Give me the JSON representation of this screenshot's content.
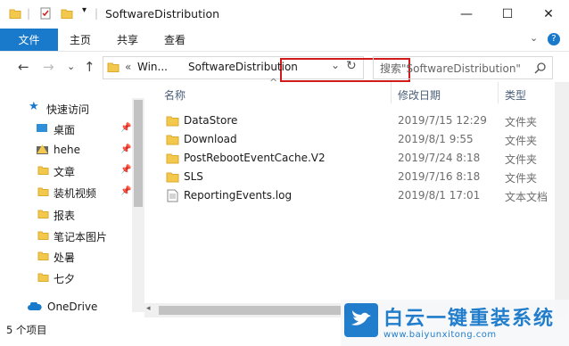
{
  "window": {
    "title": "SoftwareDistribution",
    "minimize_glyph": "—",
    "maximize_glyph": "☐",
    "close_glyph": "✕"
  },
  "ribbon": {
    "tabs": [
      "文件",
      "主页",
      "共享",
      "查看"
    ],
    "accent": "#1979ca"
  },
  "address": {
    "back": "←",
    "forward": "→",
    "recent": "⌄",
    "up": "↑",
    "ellipsis": "«",
    "parent": "Win...",
    "current": "SoftwareDistribution",
    "dropdown": "⌄",
    "refresh": "↻",
    "highlight_color": "#d21a1a"
  },
  "search": {
    "placeholder": "搜索\"SoftwareDistribution\"",
    "icon": "search-icon"
  },
  "nav": {
    "items": [
      {
        "label": "快速访问",
        "icon": "star-icon"
      },
      {
        "label": "桌面",
        "icon": "desktop-icon",
        "pinned": true
      },
      {
        "label": "hehe",
        "icon": "warning-icon",
        "pinned": true
      },
      {
        "label": "文章",
        "icon": "folder-icon",
        "pinned": true
      },
      {
        "label": "装机视频",
        "icon": "folder-icon",
        "pinned": true
      },
      {
        "label": "报表",
        "icon": "folder-icon"
      },
      {
        "label": "笔记本图片",
        "icon": "folder-icon"
      },
      {
        "label": "处暑",
        "icon": "folder-icon"
      },
      {
        "label": "七夕",
        "icon": "folder-icon"
      },
      {
        "label": "OneDrive",
        "icon": "cloud-icon"
      }
    ]
  },
  "columns": {
    "name": "名称",
    "date": "修改日期",
    "type": "类型",
    "sort_glyph": "^"
  },
  "files": [
    {
      "name": "DataStore",
      "date": "2019/7/15 12:29",
      "type": "文件夹",
      "kind": "folder"
    },
    {
      "name": "Download",
      "date": "2019/8/1 9:55",
      "type": "文件夹",
      "kind": "folder"
    },
    {
      "name": "PostRebootEventCache.V2",
      "date": "2019/7/24 8:18",
      "type": "文件夹",
      "kind": "folder"
    },
    {
      "name": "SLS",
      "date": "2019/7/16 8:18",
      "type": "文件夹",
      "kind": "folder"
    },
    {
      "name": "ReportingEvents.log",
      "date": "2019/8/1 17:01",
      "type": "文本文档",
      "kind": "file"
    }
  ],
  "status": {
    "count": "5 个项目"
  },
  "watermark": {
    "brand": "白云一键重装系统",
    "url": "www.baiyunxitong.com"
  },
  "colors": {
    "folder": "#f2c94c",
    "folder_dark": "#dcaa2e",
    "header_text": "#4c607a"
  }
}
